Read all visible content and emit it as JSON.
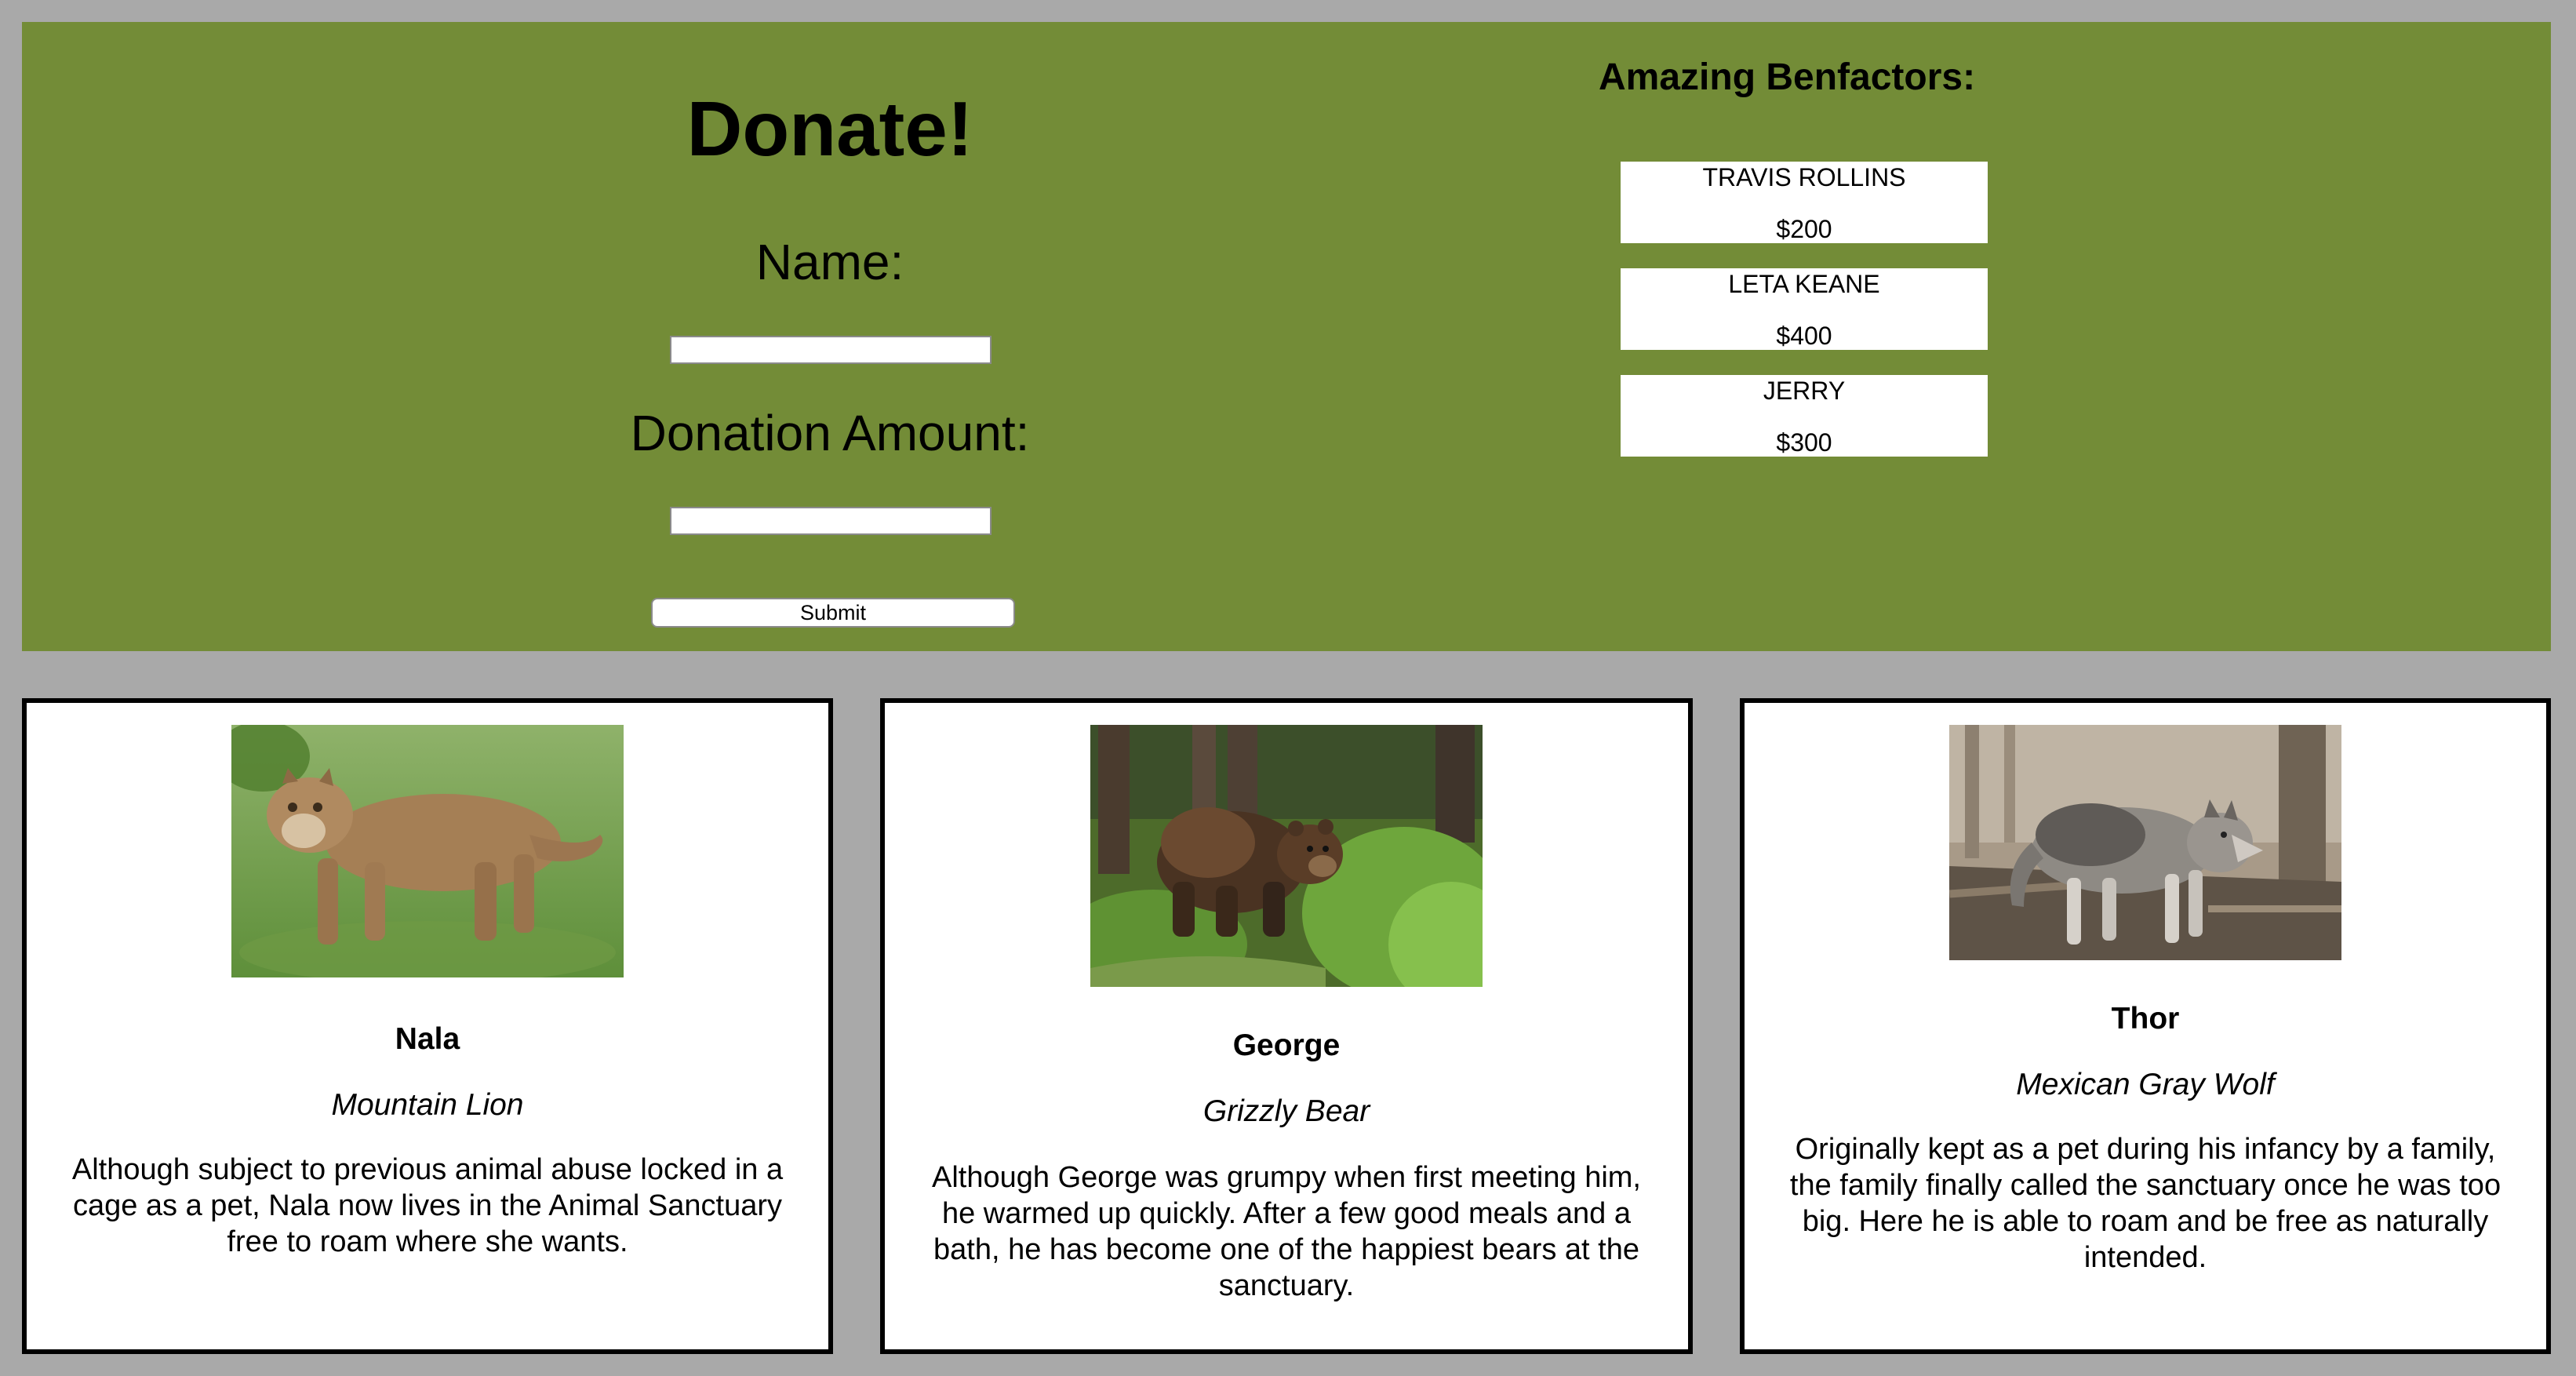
{
  "form": {
    "title": "Donate!",
    "name_label": "Name:",
    "name_value": "",
    "amount_label": "Donation Amount:",
    "amount_value": "",
    "submit_label": "Submit"
  },
  "benefactors": {
    "title": "Amazing Benfactors:",
    "items": [
      {
        "name": "TRAVIS ROLLINS",
        "amount": "$200"
      },
      {
        "name": "LETA KEANE",
        "amount": "$400"
      },
      {
        "name": "JERRY",
        "amount": "$300"
      }
    ]
  },
  "animals": [
    {
      "name": "Nala",
      "species": "Mountain Lion",
      "story": "Although subject to previous animal abuse locked in a cage as a pet, Nala now lives in the Animal Sanctuary free to roam where she wants.",
      "photo": "mountain-lion-photo"
    },
    {
      "name": "George",
      "species": "Grizzly Bear",
      "story": "Although George was grumpy when first meeting him, he warmed up quickly. After a few good meals and a bath, he has become one of the happiest bears at the sanctuary.",
      "photo": "grizzly-bear-photo"
    },
    {
      "name": "Thor",
      "species": "Mexican Gray Wolf",
      "story": "Originally kept as a pet during his infancy by a family, the family finally called the sanctuary once he was too big. Here he is able to roam and be free as naturally intended.",
      "photo": "gray-wolf-photo"
    }
  ],
  "colors": {
    "page_background": "#a9a9a9",
    "banner_background": "#738c37",
    "card_background": "#ffffff",
    "card_border": "#000000"
  }
}
